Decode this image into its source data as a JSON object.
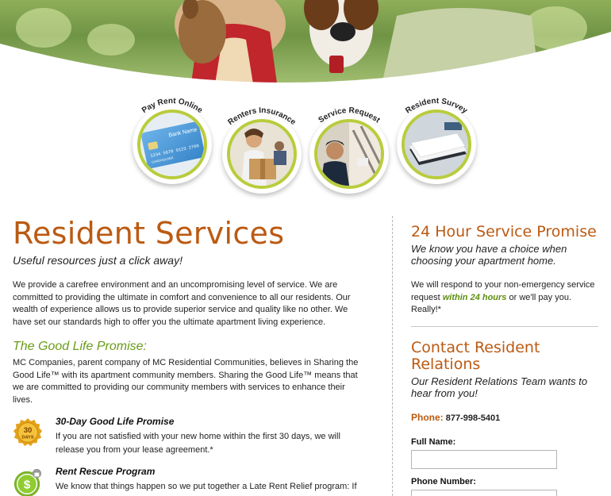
{
  "nav": {
    "items": [
      {
        "label": "Pay Rent Online"
      },
      {
        "label": "Renters Insurance"
      },
      {
        "label": "Service Request"
      },
      {
        "label": "Resident Survey"
      }
    ],
    "card_text": "Bank Name",
    "card_number": "1234 5678 9123 2700",
    "card_holder": "CARDHOLDER"
  },
  "main": {
    "title": "Resident Services",
    "subtitle": "Useful resources just a click away!",
    "intro": "We provide a carefree environment and an uncompromising level of service. We are committed to providing the ultimate in comfort and convenience to all our residents. Our wealth of experience allows us to provide superior service and quality like no other. We have set our standards high to offer you the ultimate apartment living experience.",
    "promise_heading": "The Good Life Promise:",
    "promise_text": "MC Companies, parent company of MC Residential Communities, believes in Sharing the Good Life™ with its apartment community members. Sharing the Good Life™ means that we are committed to providing our community members with services to enhance their lives.",
    "features": [
      {
        "badge_top": "30",
        "badge_bottom": "DAYS",
        "title": "30-Day Good Life Promise",
        "text": "If you are not satisfied with your new home within the first 30 days, we will release you from your lease agreement.*"
      },
      {
        "badge_symbol": "$",
        "title": "Rent Rescue Program",
        "text": "We know that things happen so we put together a Late Rent Relief program: If for some reason you cannot pay your rent on time, we will waive your late fees (this is a"
      }
    ]
  },
  "side": {
    "service_heading": "24 Hour Service Promise",
    "service_sub": "We know you have a choice when choosing your apartment home.",
    "service_text_before": "We will respond to your non-emergency service request ",
    "service_highlight": "within 24 hours",
    "service_text_after": " or we'll pay you. Really!*",
    "contact_heading": "Contact Resident Relations",
    "contact_sub": "Our Resident Relations Team wants to hear from you!",
    "phone_label": "Phone:",
    "phone_number": "877-998-5401",
    "form": {
      "full_name_label": "Full Name:",
      "full_name_value": "",
      "phone_label": "Phone Number:",
      "phone_value": ""
    }
  },
  "colors": {
    "heading_orange": "#bb5a12",
    "promise_green": "#6a9c18",
    "ring_green": "#b9cc3c"
  }
}
